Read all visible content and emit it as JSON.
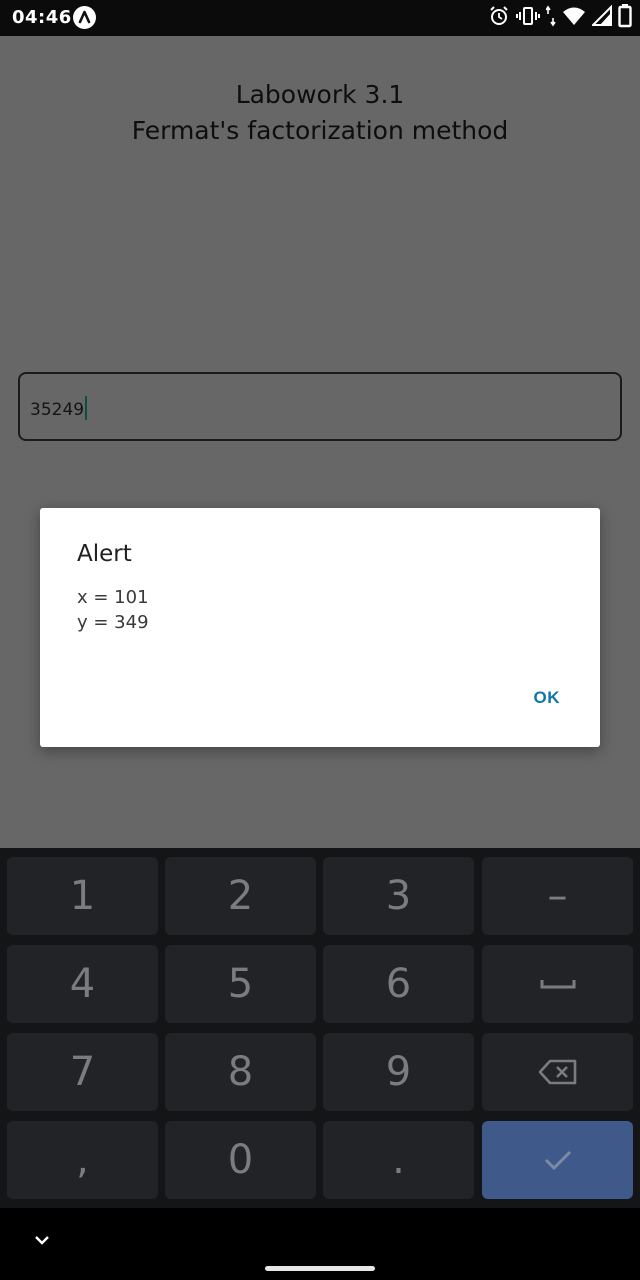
{
  "status_bar": {
    "time": "04:46",
    "icons": [
      "app-badge-icon",
      "alarm-icon",
      "vibrate-icon",
      "wifi-icon",
      "signal-icon",
      "battery-icon"
    ]
  },
  "app": {
    "title_line1": "Labowork 3.1",
    "title_line2": "Fermat's factorization method",
    "input_value": "35249"
  },
  "dialog": {
    "title": "Alert",
    "message": "x = 101\ny = 349",
    "ok_label": "OK"
  },
  "keyboard": {
    "row1": [
      "1",
      "2",
      "3",
      "–"
    ],
    "row2": [
      "4",
      "5",
      "6"
    ],
    "row3": [
      "7",
      "8",
      "9"
    ],
    "row4": [
      ",",
      "0",
      "."
    ],
    "icons": [
      "space-icon",
      "backspace-icon",
      "checkmark-icon"
    ],
    "enter_color": "#3f5a8a"
  },
  "navbar": {
    "icons": [
      "chevron-down-icon",
      "home-handle"
    ]
  }
}
